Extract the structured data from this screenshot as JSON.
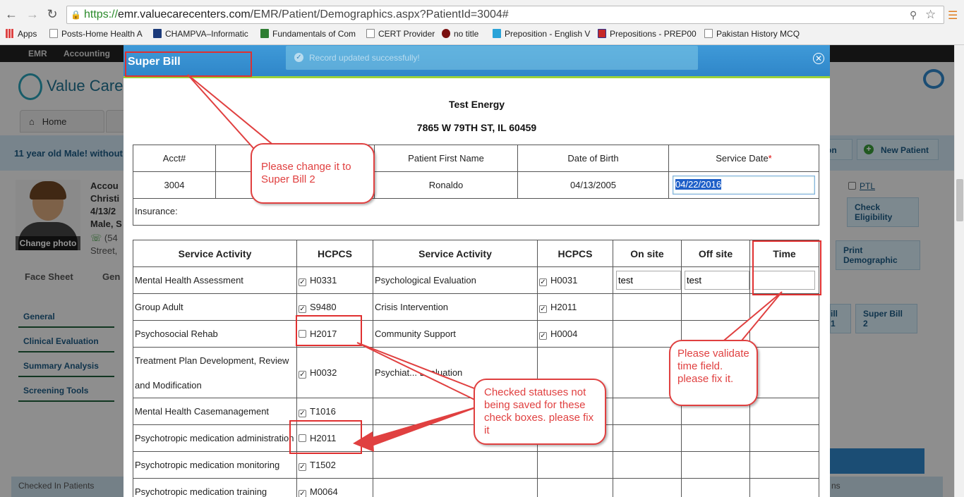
{
  "browser": {
    "url_scheme": "https://",
    "url_host": "emr.valuecarecenters.com",
    "url_path": "/EMR/Patient/Demographics.aspx?PatientId=3004#",
    "bookmarks": [
      "Apps",
      "Posts-Home Health A",
      "CHAMPVA–Informatic",
      "Fundamentals of Com",
      "CERT Provider",
      "no title",
      "Preposition - English V",
      "Prepositions - PREP00",
      "Pakistan History MCQ"
    ]
  },
  "background_page": {
    "nav": [
      "EMR",
      "Accounting"
    ],
    "logo": "Value Care",
    "home_tab": "Home",
    "alert_text": "11 year old Male! without",
    "new_patient_button": "New Patient",
    "partial_button": "on",
    "patient_lines": [
      "Accou",
      "Christi",
      "4/13/2",
      "Male, S",
      "(54",
      "Street,"
    ],
    "change_photo": "Change photo",
    "ptl_label": "PTL",
    "check_eligibility": "Check Eligibility",
    "print_demographic": "Print Demographic",
    "face_sheet": "Face Sheet",
    "gen_tab": "Gen",
    "left_menu": [
      "General",
      "Clinical Evaluation",
      "Summary Analysis",
      "Screening Tools"
    ],
    "super_bill_tabs": [
      "ill 1",
      "Super Bill 2"
    ],
    "bottom_bar": "Checked In Patients",
    "bottom_right": "ns"
  },
  "modal": {
    "title": "Super Bill",
    "toast": "Record updated successfully!",
    "org_name": "Test Energy",
    "org_address": "7865 W 79TH ST, IL 60459",
    "patient_headers": [
      "Acct#",
      "",
      "Patient First Name",
      "Date of Birth",
      "Service Date"
    ],
    "patient_values": [
      "3004",
      "",
      "Ronaldo",
      "04/13/2005"
    ],
    "service_date_value": "04/22/2016",
    "insurance_label": "Insurance:",
    "service_headers": [
      "Service Activity",
      "HCPCS",
      "Service Activity",
      "HCPCS",
      "On site",
      "Off site",
      "Time"
    ],
    "rows": [
      {
        "act1": "Mental Health Assessment",
        "code1": "H0331",
        "chk1": true,
        "act2": "Psychological Evaluation",
        "code2": "H0031",
        "chk2": true
      },
      {
        "act1": "Group Adult",
        "code1": "S9480",
        "chk1": true,
        "act2": "Crisis Intervention",
        "code2": "H2011",
        "chk2": true
      },
      {
        "act1": "Psychosocial Rehab",
        "code1": "H2017",
        "chk1": false,
        "act2": "Community Support",
        "code2": "H0004",
        "chk2": true
      },
      {
        "act1": "Treatment Plan Development, Review and Modification",
        "code1": "H0032",
        "chk1": true,
        "act2": "Psychiat... Evaluation",
        "code2": "",
        "chk2": false
      },
      {
        "act1": "Mental Health Casemanagement",
        "code1": "T1016",
        "chk1": true,
        "act2": "",
        "code2": "",
        "chk2": false
      },
      {
        "act1": "Psychotropic medication administration",
        "code1": "H2011",
        "chk1": false,
        "act2": "",
        "code2": "",
        "chk2": false
      },
      {
        "act1": "Psychotropic medication monitoring",
        "code1": "T1502",
        "chk1": true,
        "act2": "",
        "code2": "",
        "chk2": false
      },
      {
        "act1": "Psychotropic medication training",
        "code1": "M0064",
        "chk1": true,
        "act2": "",
        "code2": "",
        "chk2": false
      }
    ],
    "onsite_value": "test",
    "offsite_value": "test",
    "time_value": ""
  },
  "annotations": {
    "rename": "Please change it to Super Bill 2",
    "time": "Please validate time field. please fix it.",
    "checkbox": "Checked statuses not being saved for these check boxes. please fix it"
  },
  "colors": {
    "annotation": "#e03030",
    "modal_header": "#2f86c9",
    "accent_green": "#9cd23a"
  }
}
